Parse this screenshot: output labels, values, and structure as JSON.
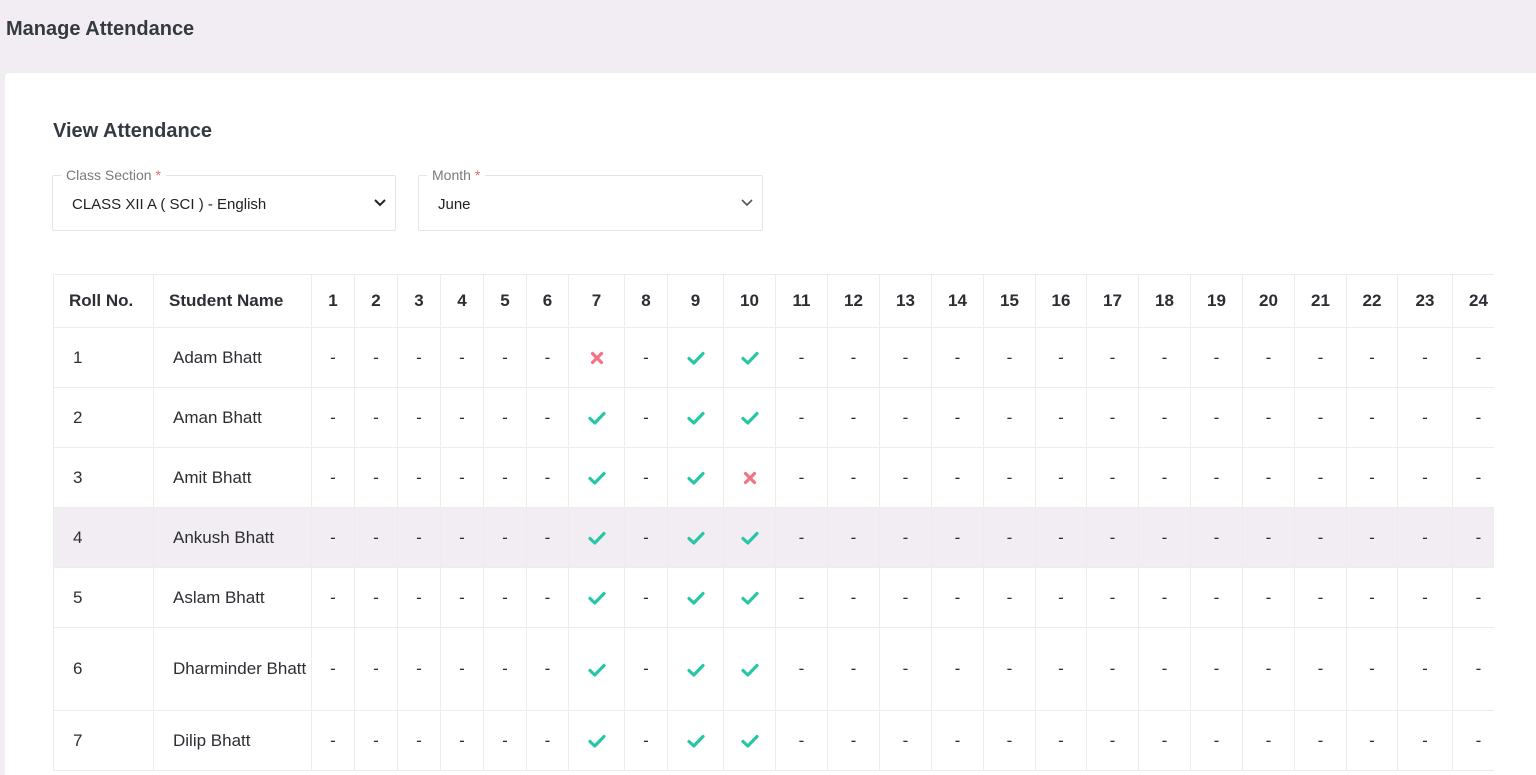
{
  "page": {
    "title": "Manage Attendance"
  },
  "card": {
    "title": "View Attendance"
  },
  "filters": {
    "class_section": {
      "label": "Class Section",
      "required": "*",
      "value": "CLASS XII A ( SCI ) - English"
    },
    "month": {
      "label": "Month",
      "required": "*",
      "value": "June"
    }
  },
  "table": {
    "headers": {
      "roll": "Roll No.",
      "name": "Student Name"
    },
    "days": [
      "1",
      "2",
      "3",
      "4",
      "5",
      "6",
      "7",
      "8",
      "9",
      "10",
      "11",
      "12",
      "13",
      "14",
      "15",
      "16",
      "17",
      "18",
      "19",
      "20",
      "21",
      "22",
      "23",
      "24"
    ],
    "rows": [
      {
        "roll": "1",
        "name": "Adam Bhatt",
        "marks": [
          "-",
          "-",
          "-",
          "-",
          "-",
          "-",
          "A",
          "-",
          "P",
          "P",
          "-",
          "-",
          "-",
          "-",
          "-",
          "-",
          "-",
          "-",
          "-",
          "-",
          "-",
          "-",
          "-",
          "-"
        ]
      },
      {
        "roll": "2",
        "name": "Aman Bhatt",
        "marks": [
          "-",
          "-",
          "-",
          "-",
          "-",
          "-",
          "P",
          "-",
          "P",
          "P",
          "-",
          "-",
          "-",
          "-",
          "-",
          "-",
          "-",
          "-",
          "-",
          "-",
          "-",
          "-",
          "-",
          "-"
        ]
      },
      {
        "roll": "3",
        "name": "Amit Bhatt",
        "marks": [
          "-",
          "-",
          "-",
          "-",
          "-",
          "-",
          "P",
          "-",
          "P",
          "A",
          "-",
          "-",
          "-",
          "-",
          "-",
          "-",
          "-",
          "-",
          "-",
          "-",
          "-",
          "-",
          "-",
          "-"
        ]
      },
      {
        "roll": "4",
        "name": "Ankush Bhatt",
        "marks": [
          "-",
          "-",
          "-",
          "-",
          "-",
          "-",
          "P",
          "-",
          "P",
          "P",
          "-",
          "-",
          "-",
          "-",
          "-",
          "-",
          "-",
          "-",
          "-",
          "-",
          "-",
          "-",
          "-",
          "-"
        ]
      },
      {
        "roll": "5",
        "name": "Aslam Bhatt",
        "marks": [
          "-",
          "-",
          "-",
          "-",
          "-",
          "-",
          "P",
          "-",
          "P",
          "P",
          "-",
          "-",
          "-",
          "-",
          "-",
          "-",
          "-",
          "-",
          "-",
          "-",
          "-",
          "-",
          "-",
          "-"
        ]
      },
      {
        "roll": "6",
        "name": "Dharminder Bhatt",
        "marks": [
          "-",
          "-",
          "-",
          "-",
          "-",
          "-",
          "P",
          "-",
          "P",
          "P",
          "-",
          "-",
          "-",
          "-",
          "-",
          "-",
          "-",
          "-",
          "-",
          "-",
          "-",
          "-",
          "-",
          "-"
        ]
      },
      {
        "roll": "7",
        "name": "Dilip Bhatt",
        "marks": [
          "-",
          "-",
          "-",
          "-",
          "-",
          "-",
          "P",
          "-",
          "P",
          "P",
          "-",
          "-",
          "-",
          "-",
          "-",
          "-",
          "-",
          "-",
          "-",
          "-",
          "-",
          "-",
          "-",
          "-"
        ]
      }
    ],
    "highlighted_row": 3
  },
  "colors": {
    "present": "#26c6a6",
    "absent": "#f27386",
    "highlight": "#f2edf3"
  },
  "icons": {
    "present": "check-icon",
    "absent": "cross-icon",
    "dropdown": "chevron-down-icon"
  }
}
